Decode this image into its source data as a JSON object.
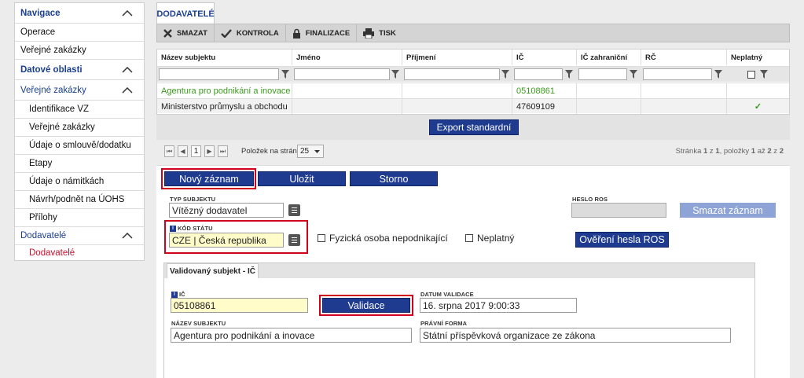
{
  "sidebar": {
    "items": [
      {
        "label": "Navigace"
      },
      {
        "label": "Operace"
      },
      {
        "label": "Veřejné zakázky"
      },
      {
        "label": "Datové oblasti"
      },
      {
        "label": "Veřejné zakázky"
      },
      {
        "label": "Identifikace VZ"
      },
      {
        "label": "Veřejné zakázky"
      },
      {
        "label": "Údaje o smlouvě/dodatku"
      },
      {
        "label": "Etapy"
      },
      {
        "label": "Údaje o námitkách"
      },
      {
        "label": "Návrh/podnět na ÚOHS"
      },
      {
        "label": "Přílohy"
      },
      {
        "label": "Dodavatelé"
      },
      {
        "label": "Dodavatelé"
      }
    ]
  },
  "tab": {
    "label": "DODAVATELÉ"
  },
  "toolbar": {
    "delete": "SMAZAT",
    "check": "KONTROLA",
    "finalize": "FINALIZACE",
    "print": "TISK"
  },
  "grid": {
    "columns": [
      "Název subjektu",
      "Jméno",
      "Příjmení",
      "IČ",
      "IČ zahraniční",
      "RČ",
      "Neplatný"
    ],
    "rows": [
      {
        "name": "Agentura pro podnikání a inovace",
        "ic": "05108861"
      },
      {
        "name": "Ministerstvo průmyslu a obchodu",
        "ic": "47609109",
        "check": "✓"
      }
    ]
  },
  "export_label": "Export standardní",
  "pager": {
    "page": "1",
    "per_page_label": "Položek na stránku",
    "per_page": "25",
    "summary_a": "Stránka ",
    "page_cur": "1",
    "summary_b": " z ",
    "page_total": "1",
    "summary_c": ", položky ",
    "item_from": "1",
    "summary_d": " až ",
    "item_to": "2",
    "summary_e": " z ",
    "item_total": "2"
  },
  "form": {
    "new_record": "Nový záznam",
    "save": "Uložit",
    "cancel": "Storno",
    "subject_type_label": "TYP SUBJEKTU",
    "subject_type_value": "Vítězný dodavatel",
    "ros_password_label": "HESLO ROS",
    "delete_record": "Smazat záznam",
    "country_label": "KÓD STÁTU",
    "country_value": "CZE | Česká republika",
    "natural_person_label": "Fyzická osoba nepodnikající",
    "invalid_label": "Neplatný",
    "verify_ros": "Ověření hesla ROS"
  },
  "validated": {
    "tab_label": "Validovaný subjekt - IČ",
    "ic_label": "IČ",
    "ic_value": "05108861",
    "validate": "Validace",
    "date_label": "DATUM VALIDACE",
    "date_value": "16. srpna 2017 9:00:33",
    "name_label": "NÁZEV SUBJEKTU",
    "name_value": "Agentura pro podnikání a inovace",
    "legal_label": "PRÁVNÍ FORMA",
    "legal_value": "Státní příspěvková organizace ze zákona"
  },
  "colors": {
    "navy": "#1f3b8f",
    "highlight_red": "#d0021b",
    "active_red": "#c8102e",
    "green_row": "#3a9a1c"
  }
}
